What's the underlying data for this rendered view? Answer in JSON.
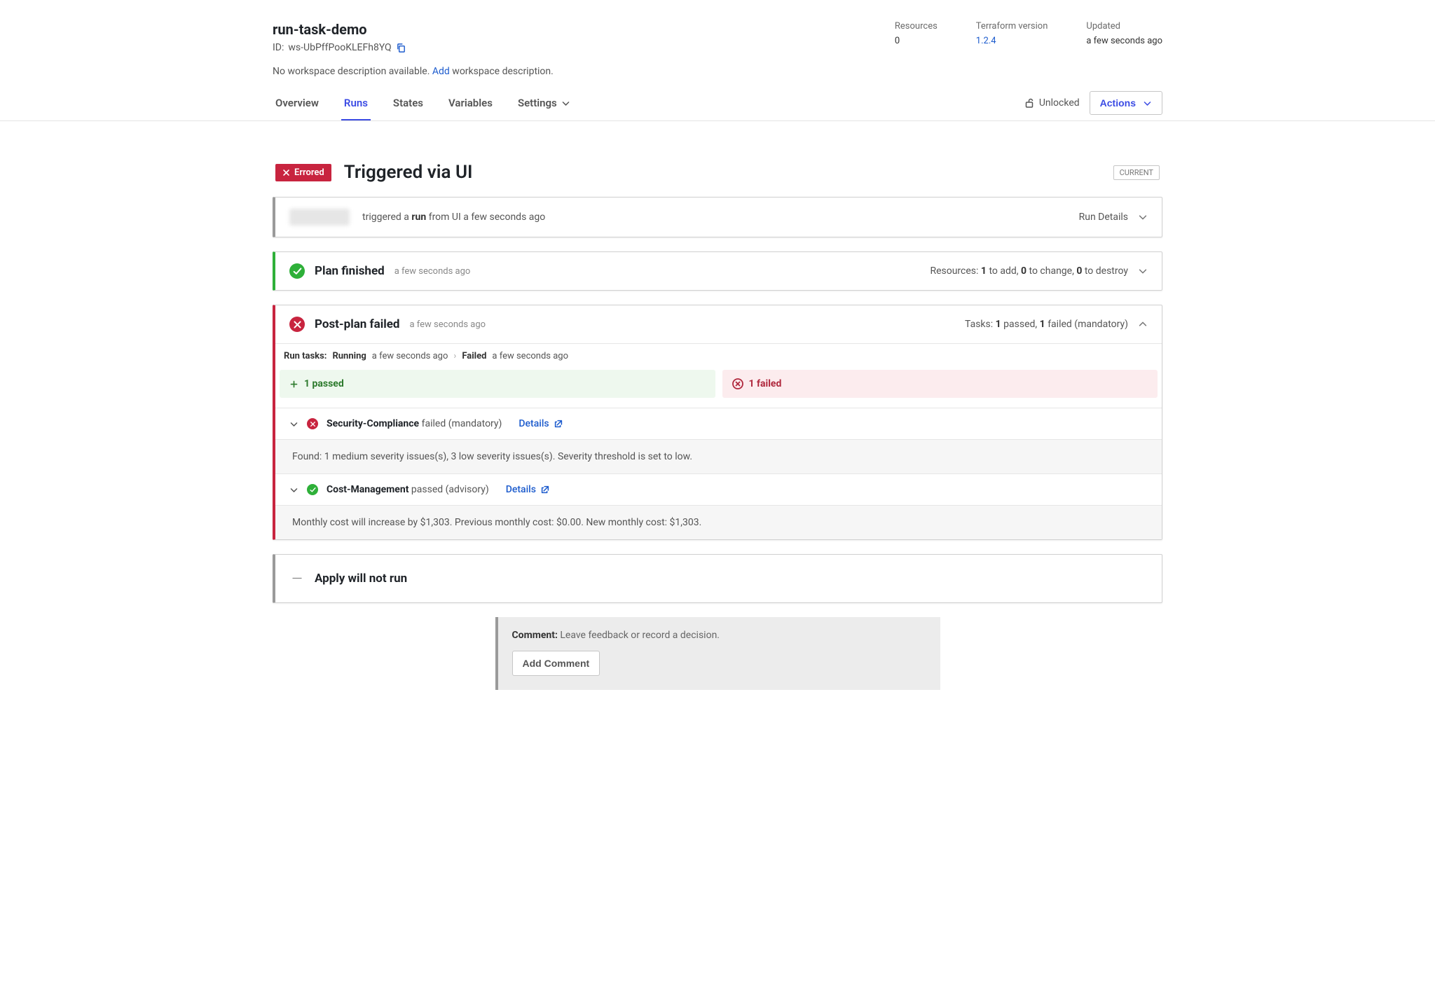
{
  "header": {
    "workspace_name": "run-task-demo",
    "workspace_id_label": "ID:",
    "workspace_id": "ws-UbPffPooKLEFh8YQ",
    "description_prefix": "No workspace description available.",
    "description_add": "Add",
    "description_suffix": "workspace description.",
    "meta": {
      "resources": {
        "label": "Resources",
        "value": "0"
      },
      "terraform": {
        "label": "Terraform version",
        "value": "1.2.4"
      },
      "updated": {
        "label": "Updated",
        "value": "a few seconds ago"
      }
    }
  },
  "tabs": {
    "items": [
      "Overview",
      "Runs",
      "States",
      "Variables",
      "Settings"
    ],
    "active_index": 1,
    "lock_state": "Unlocked",
    "actions_label": "Actions"
  },
  "run": {
    "status_badge": "Errored",
    "title": "Triggered via UI",
    "current_badge": "CURRENT"
  },
  "trigger": {
    "prefix": "triggered a",
    "bold": "run",
    "suffix": "from UI a few seconds ago",
    "details_label": "Run Details"
  },
  "plan": {
    "title": "Plan finished",
    "timestamp": "a few seconds ago",
    "summary_prefix": "Resources:",
    "to_add": "1",
    "to_add_label": "to add,",
    "to_change": "0",
    "to_change_label": "to change,",
    "to_destroy": "0",
    "to_destroy_label": "to destroy"
  },
  "postplan": {
    "title": "Post-plan failed",
    "timestamp": "a few seconds ago",
    "summary_prefix": "Tasks:",
    "passed": "1",
    "passed_label": "passed,",
    "failed": "1",
    "failed_label": "failed (mandatory)",
    "crumbs": {
      "label": "Run tasks:",
      "running": "Running",
      "running_ts": "a few seconds ago",
      "failed": "Failed",
      "failed_ts": "a few seconds ago"
    },
    "pass_box": "1 passed",
    "fail_box": "1 failed",
    "tasks": [
      {
        "name": "Security-Compliance",
        "tail": "failed (mandatory)",
        "details": "Details",
        "body": "Found: 1 medium severity issues(s), 3 low severity issues(s). Severity threshold is set to low."
      },
      {
        "name": "Cost-Management",
        "tail": "passed (advisory)",
        "details": "Details",
        "body": "Monthly cost will increase by $1,303. Previous monthly cost: $0.00. New monthly cost: $1,303."
      }
    ]
  },
  "apply": {
    "title": "Apply will not run"
  },
  "comment": {
    "label": "Comment:",
    "hint": "Leave feedback or record a decision.",
    "button": "Add Comment"
  }
}
